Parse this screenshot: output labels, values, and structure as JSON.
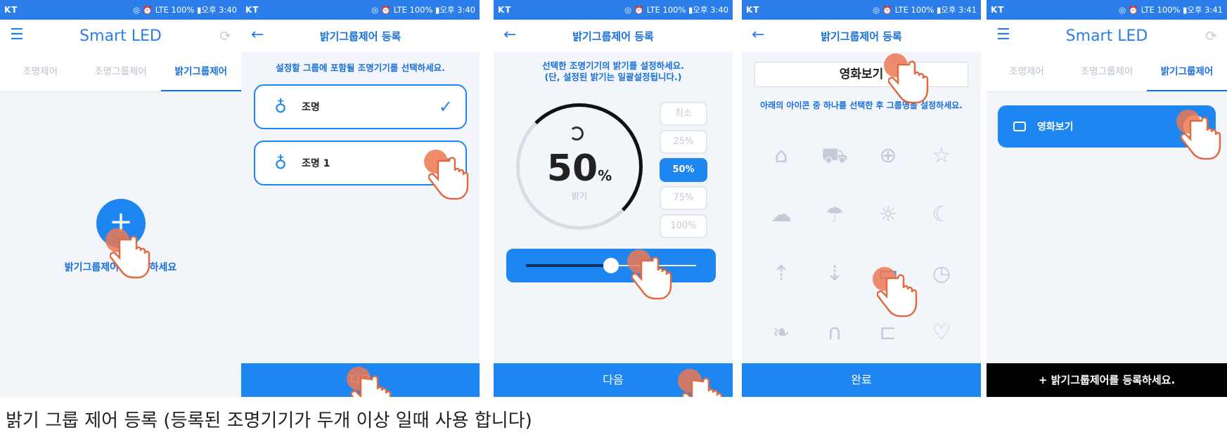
{
  "status": {
    "carrier": "KT",
    "right_3_40": "◎ ⏰ LTE 100% ▮오후 3:40",
    "right_3_41": "◎ ⏰ LTE 100% ▮오후 3:41"
  },
  "p1": {
    "title": "Smart LED",
    "tabs": [
      "조명제어",
      "조명그룹제어",
      "밝기그룹제어"
    ],
    "add_text": "밝기그룹제어를 등록하세요"
  },
  "p2": {
    "title": "밝기그룹제어 등록",
    "hint": "설정할 그룹에 포함될 조명기기를 선택하세요.",
    "devices": [
      "조명",
      "조명 1"
    ],
    "next": "다음"
  },
  "p3": {
    "title": "밝기그룹제어 등록",
    "hint_1": "선택한 조명기기의 밝기를 설정하세요.",
    "hint_2": "(단, 설정된 밝기는 일괄설정됩니다.)",
    "value": "50",
    "unit": "%",
    "sub_label": "밝기",
    "levels": [
      "최소",
      "25%",
      "50%",
      "75%",
      "100%"
    ],
    "selected_level": "50%",
    "slider_value": 0.5,
    "next": "다음"
  },
  "p4": {
    "title": "밝기그룹제어 등록",
    "name_value": "영화보기",
    "hint": "아래의 아이콘 중 하나를 선택한 후 그룹명을 설정하세요.",
    "icons": [
      "home-icon",
      "cart-icon",
      "lifebuoy-icon",
      "star-icon",
      "cloud-icon",
      "umbrella-icon",
      "sun-icon",
      "moon-icon",
      "sunrise-icon",
      "sunset-icon",
      "video-camera-icon",
      "clock-icon",
      "leaf-icon",
      "headphones-icon",
      "book-icon",
      "heart-icon"
    ],
    "selected_icon": "video-camera-icon",
    "done": "완료"
  },
  "p5": {
    "title": "Smart LED",
    "tabs": [
      "조명제어",
      "조명그룹제어",
      "밝기그룹제어"
    ],
    "group_name": "영화보기",
    "bottom": "+ 밝기그룹제어를 등록하세요."
  },
  "caption": "밝기 그룹 제어 등록 (등록된 조명기기가 두개 이상 일때 사용 합니다)",
  "colors": {
    "primary": "#1e86f0",
    "accent_hand": "#ec7852"
  }
}
